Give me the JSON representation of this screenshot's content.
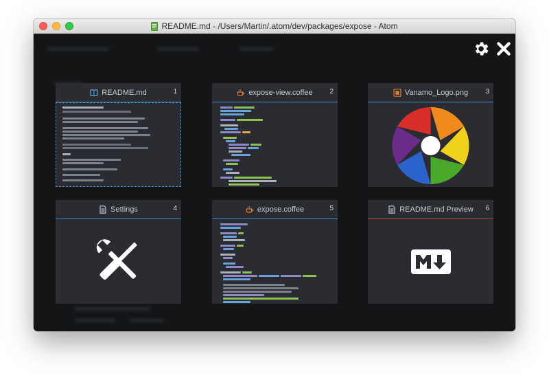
{
  "window": {
    "title": "README.md - /Users/Martin/.atom/dev/packages/expose - Atom"
  },
  "toolbar": {
    "settings_icon": "gear-icon",
    "close_icon": "close-icon"
  },
  "tiles": [
    {
      "label": "README.md",
      "number": "1",
      "icon": "book-icon",
      "icon_color": "#5aa0d6",
      "selected": true
    },
    {
      "label": "expose-view.coffee",
      "number": "2",
      "icon": "coffee-icon",
      "icon_color": "#e07b3c"
    },
    {
      "label": "Vanamo_Logo.png",
      "number": "3",
      "icon": "image-file-icon",
      "icon_color": "#e07b3c"
    },
    {
      "label": "Settings",
      "number": "4",
      "icon": "document-icon",
      "icon_color": "#c8ccd2"
    },
    {
      "label": "expose.coffee",
      "number": "5",
      "icon": "coffee-icon",
      "icon_color": "#e07b3c"
    },
    {
      "label": "README.md Preview",
      "number": "6",
      "icon": "document-icon",
      "icon_color": "#c8ccd2"
    }
  ],
  "colors": {
    "tab_border_active": "#3b8fd0",
    "tab_border_preview": "#c94a4a",
    "tile_bg": "#2a2c31"
  }
}
